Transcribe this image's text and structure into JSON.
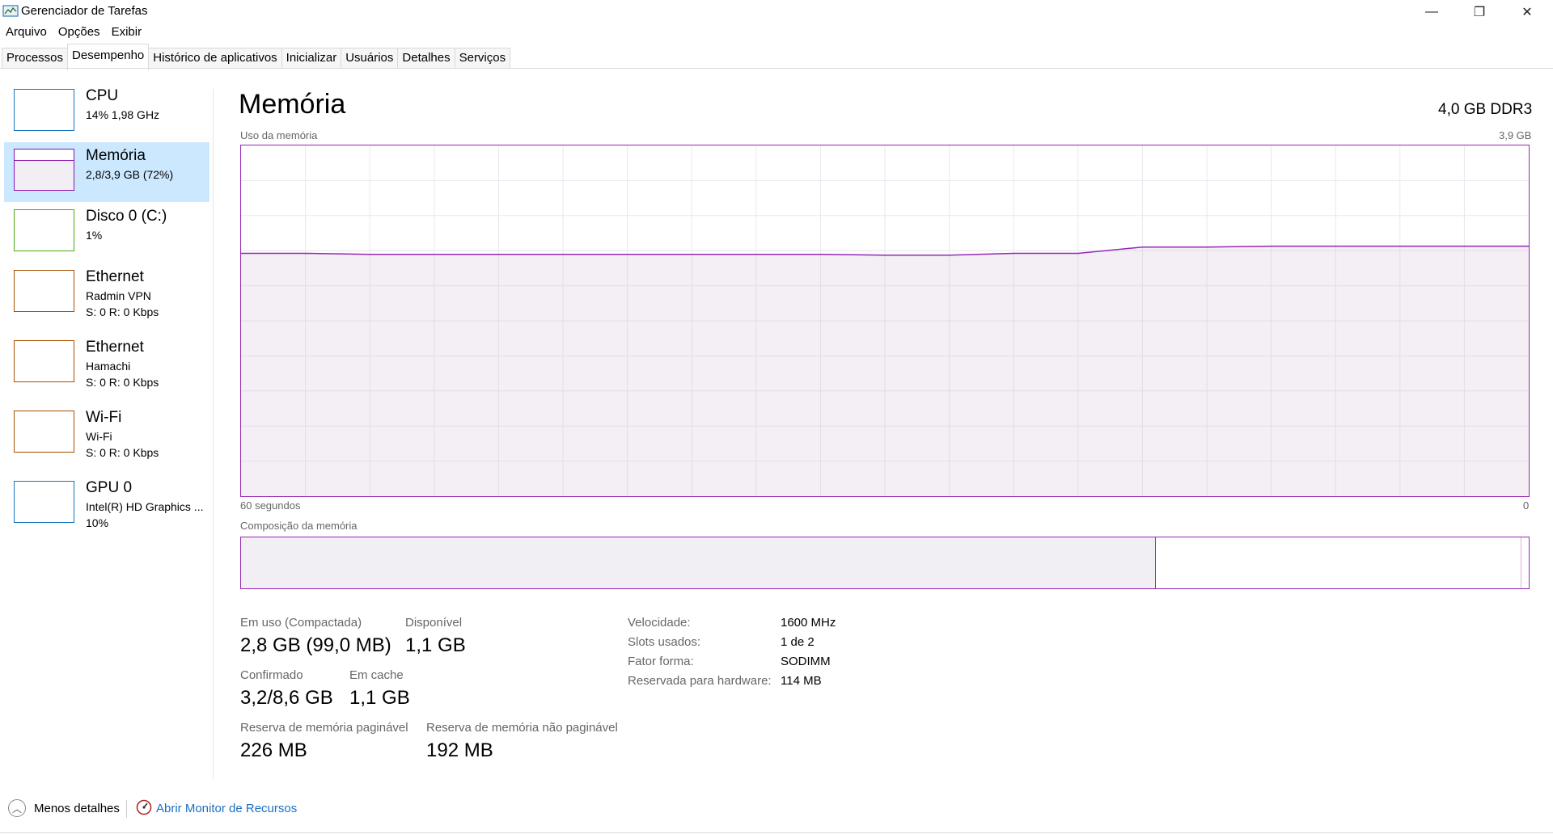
{
  "window": {
    "title": "Gerenciador de Tarefas",
    "controls": {
      "minimize": "—",
      "restore": "❐",
      "close": "✕"
    }
  },
  "menu": [
    "Arquivo",
    "Opções",
    "Exibir"
  ],
  "tabs": [
    {
      "label": "Processos"
    },
    {
      "label": "Desempenho",
      "active": true
    },
    {
      "label": "Histórico de aplicativos"
    },
    {
      "label": "Inicializar"
    },
    {
      "label": "Usuários"
    },
    {
      "label": "Detalhes"
    },
    {
      "label": "Serviços"
    }
  ],
  "sidebar": {
    "items": [
      {
        "name": "CPU",
        "sub1": "14%  1,98 GHz",
        "sub2": "",
        "color": "#1174bb",
        "selected": false
      },
      {
        "name": "Memória",
        "sub1": "2,8/3,9 GB (72%)",
        "sub2": "",
        "color": "#8b12ae",
        "selected": true,
        "fill": 0.72
      },
      {
        "name": "Disco 0 (C:)",
        "sub1": "1%",
        "sub2": "",
        "color": "#4da60c",
        "selected": false
      },
      {
        "name": "Ethernet",
        "sub1": "Radmin VPN",
        "sub2": "S: 0 R: 0 Kbps",
        "color": "#a74f01",
        "selected": false
      },
      {
        "name": "Ethernet",
        "sub1": "Hamachi",
        "sub2": "S: 0 R: 0 Kbps",
        "color": "#a74f01",
        "selected": false
      },
      {
        "name": "Wi-Fi",
        "sub1": "Wi-Fi",
        "sub2": "S: 0 R: 0 Kbps",
        "color": "#a74f01",
        "selected": false
      },
      {
        "name": "GPU 0",
        "sub1": "Intel(R) HD Graphics ...",
        "sub2": "10%",
        "color": "#1174bb",
        "selected": false
      }
    ]
  },
  "main": {
    "title": "Memória",
    "spec": "4,0 GB DDR3",
    "usage_label": "Uso da memória",
    "usage_max": "3,9 GB",
    "time_label": "60 segundos",
    "time_zero": "0",
    "composition_label": "Composição da memória",
    "composition": {
      "in_use": 0.71,
      "modified": 0.0,
      "standby": 0.28
    },
    "stats": {
      "in_use_label": "Em uso (Compactada)",
      "in_use_value": "2,8 GB (99,0 MB)",
      "available_label": "Disponível",
      "available_value": "1,1 GB",
      "committed_label": "Confirmado",
      "committed_value": "3,2/8,6 GB",
      "cached_label": "Em cache",
      "cached_value": "1,1 GB",
      "paged_label": "Reserva de memória paginável",
      "paged_value": "226 MB",
      "nonpaged_label": "Reserva de memória não paginável",
      "nonpaged_value": "192 MB"
    },
    "specs": {
      "speed_label": "Velocidade:",
      "speed_value": "1600 MHz",
      "slots_label": "Slots usados:",
      "slots_value": "1 de 2",
      "form_label": "Fator forma:",
      "form_value": "SODIMM",
      "reserved_label": "Reservada para hardware:",
      "reserved_value": "114 MB"
    }
  },
  "footer": {
    "less_details": "Menos detalhes",
    "open_monitor": "Abrir Monitor de Recursos"
  },
  "chart_data": {
    "type": "area",
    "title": "Uso da memória",
    "xlabel": "60 segundos",
    "ylabel": "",
    "xlim": [
      60,
      0
    ],
    "ylim": [
      0,
      3.9
    ],
    "x": [
      60,
      57,
      54,
      51,
      48,
      45,
      42,
      39,
      36,
      33,
      30,
      27,
      24,
      21,
      18,
      15,
      12,
      9,
      6,
      3,
      0
    ],
    "series": [
      {
        "values": [
          2.7,
          2.7,
          2.69,
          2.69,
          2.69,
          2.69,
          2.69,
          2.69,
          2.69,
          2.69,
          2.68,
          2.68,
          2.7,
          2.7,
          2.77,
          2.77,
          2.78,
          2.78,
          2.78,
          2.78,
          2.78
        ]
      }
    ],
    "grid": true
  }
}
